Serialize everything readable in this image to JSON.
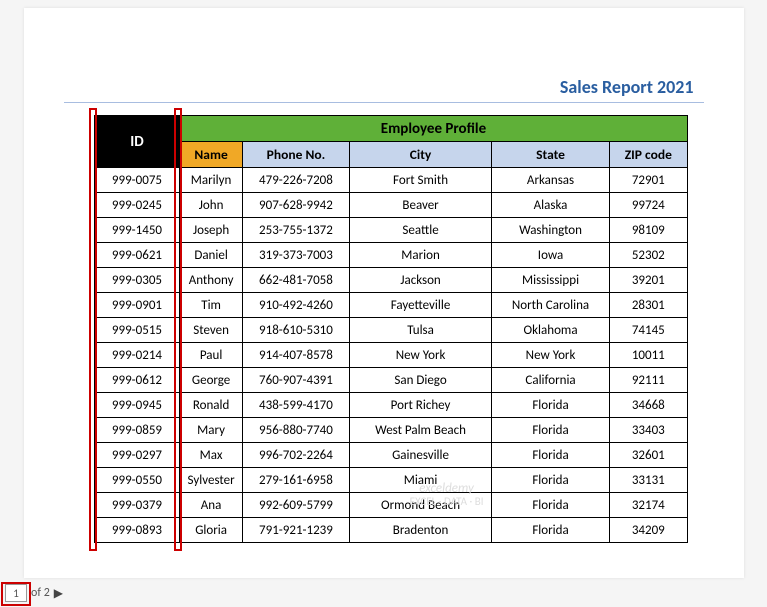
{
  "header": {
    "title": "Sales Report 2021"
  },
  "table": {
    "id_header": "ID",
    "profile_header": "Employee Profile",
    "columns": {
      "name": "Name",
      "phone": "Phone No.",
      "city": "City",
      "state": "State",
      "zip": "ZIP code"
    },
    "rows": [
      {
        "id": "999-0075",
        "name": "Marilyn",
        "phone": "479-226-7208",
        "city": "Fort Smith",
        "state": "Arkansas",
        "zip": "72901"
      },
      {
        "id": "999-0245",
        "name": "John",
        "phone": "907-628-9942",
        "city": "Beaver",
        "state": "Alaska",
        "zip": "99724"
      },
      {
        "id": "999-1450",
        "name": "Joseph",
        "phone": "253-755-1372",
        "city": "Seattle",
        "state": "Washington",
        "zip": "98109"
      },
      {
        "id": "999-0621",
        "name": "Daniel",
        "phone": "319-373-7003",
        "city": "Marion",
        "state": "Iowa",
        "zip": "52302"
      },
      {
        "id": "999-0305",
        "name": "Anthony",
        "phone": "662-481-7058",
        "city": "Jackson",
        "state": "Mississippi",
        "zip": "39201"
      },
      {
        "id": "999-0901",
        "name": "Tim",
        "phone": "910-492-4260",
        "city": "Fayetteville",
        "state": "North Carolina",
        "zip": "28301"
      },
      {
        "id": "999-0515",
        "name": "Steven",
        "phone": "918-610-5310",
        "city": "Tulsa",
        "state": "Oklahoma",
        "zip": "74145"
      },
      {
        "id": "999-0214",
        "name": "Paul",
        "phone": "914-407-8578",
        "city": "New York",
        "state": "New York",
        "zip": "10011"
      },
      {
        "id": "999-0612",
        "name": "George",
        "phone": "760-907-4391",
        "city": "San Diego",
        "state": "California",
        "zip": "92111"
      },
      {
        "id": "999-0945",
        "name": "Ronald",
        "phone": "438-599-4170",
        "city": "Port Richey",
        "state": "Florida",
        "zip": "34668"
      },
      {
        "id": "999-0859",
        "name": "Mary",
        "phone": "956-880-7740",
        "city": "West Palm Beach",
        "state": "Florida",
        "zip": "33403"
      },
      {
        "id": "999-0297",
        "name": "Max",
        "phone": "996-702-2264",
        "city": "Gainesville",
        "state": "Florida",
        "zip": "32601"
      },
      {
        "id": "999-0550",
        "name": "Sylvester",
        "phone": "279-161-6958",
        "city": "Miami",
        "state": "Florida",
        "zip": "33131"
      },
      {
        "id": "999-0379",
        "name": "Ana",
        "phone": "992-609-5799",
        "city": "Ormond Beach",
        "state": "Florida",
        "zip": "32174"
      },
      {
        "id": "999-0893",
        "name": "Gloria",
        "phone": "791-921-1239",
        "city": "Bradenton",
        "state": "Florida",
        "zip": "34209"
      }
    ]
  },
  "pager": {
    "current": "1",
    "of_text": "of 2"
  },
  "watermark": {
    "line1": "exceldemy",
    "line2": "EXCEL · DATA · BI"
  }
}
